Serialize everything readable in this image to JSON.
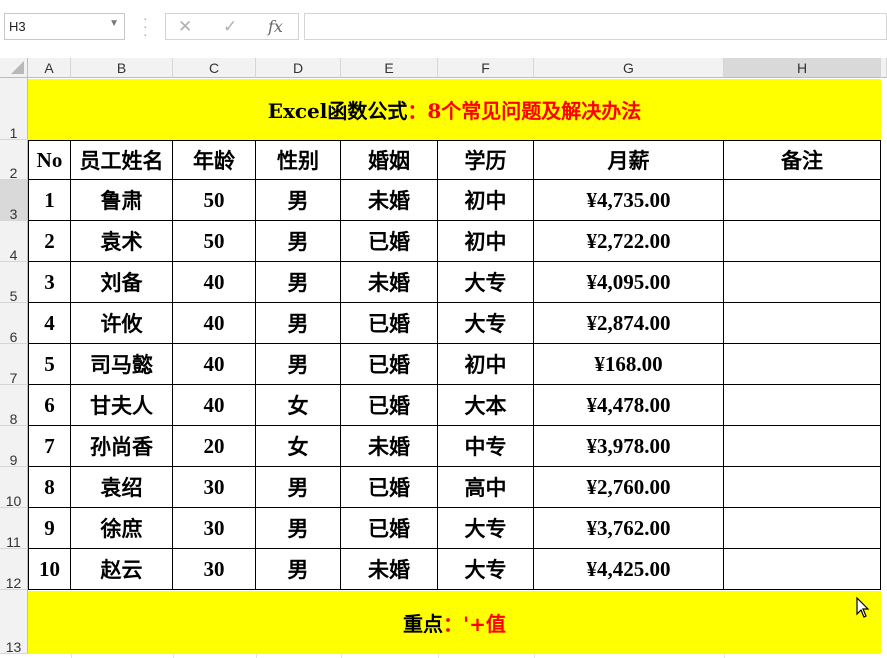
{
  "name_box": {
    "value": "H3"
  },
  "formula_bar": {
    "cancel_icon": "✕",
    "enter_icon": "✓",
    "fx_label": "fx",
    "formula_value": ""
  },
  "columns": [
    "A",
    "B",
    "C",
    "D",
    "E",
    "F",
    "G",
    "H"
  ],
  "rows": [
    "1",
    "2",
    "3",
    "4",
    "5",
    "6",
    "7",
    "8",
    "9",
    "10",
    "11",
    "12",
    "13"
  ],
  "title": {
    "black": "Excel函数公式",
    "red": "：8个常见问题及解决办法"
  },
  "table": {
    "headers": [
      "No",
      "员工姓名",
      "年龄",
      "性别",
      "婚姻",
      "学历",
      "月薪",
      "备注"
    ],
    "rows": [
      [
        "1",
        "鲁肃",
        "50",
        "男",
        "未婚",
        "初中",
        "¥4,735.00",
        ""
      ],
      [
        "2",
        "袁术",
        "50",
        "男",
        "已婚",
        "初中",
        "¥2,722.00",
        ""
      ],
      [
        "3",
        "刘备",
        "40",
        "男",
        "未婚",
        "大专",
        "¥4,095.00",
        ""
      ],
      [
        "4",
        "许攸",
        "40",
        "男",
        "已婚",
        "大专",
        "¥2,874.00",
        ""
      ],
      [
        "5",
        "司马懿",
        "40",
        "男",
        "已婚",
        "初中",
        "¥168.00",
        ""
      ],
      [
        "6",
        "甘夫人",
        "40",
        "女",
        "已婚",
        "大本",
        "¥4,478.00",
        ""
      ],
      [
        "7",
        "孙尚香",
        "20",
        "女",
        "未婚",
        "中专",
        "¥3,978.00",
        ""
      ],
      [
        "8",
        "袁绍",
        "30",
        "男",
        "已婚",
        "高中",
        "¥2,760.00",
        ""
      ],
      [
        "9",
        "徐庶",
        "30",
        "男",
        "已婚",
        "大专",
        "¥3,762.00",
        ""
      ],
      [
        "10",
        "赵云",
        "30",
        "男",
        "未婚",
        "大专",
        "¥4,425.00",
        ""
      ]
    ]
  },
  "footer": {
    "black": "重点",
    "red": "：'+值"
  },
  "colors": {
    "band_fill": "#ffff00",
    "accent_red": "#ff0000",
    "header_gray": "#f2f2f2",
    "selected_header": "#d9d9d9"
  },
  "icons": {
    "cursor": "mouse-pointer-icon",
    "dropdown": "chevron-down-icon",
    "select_all": "select-all-triangle-icon"
  }
}
